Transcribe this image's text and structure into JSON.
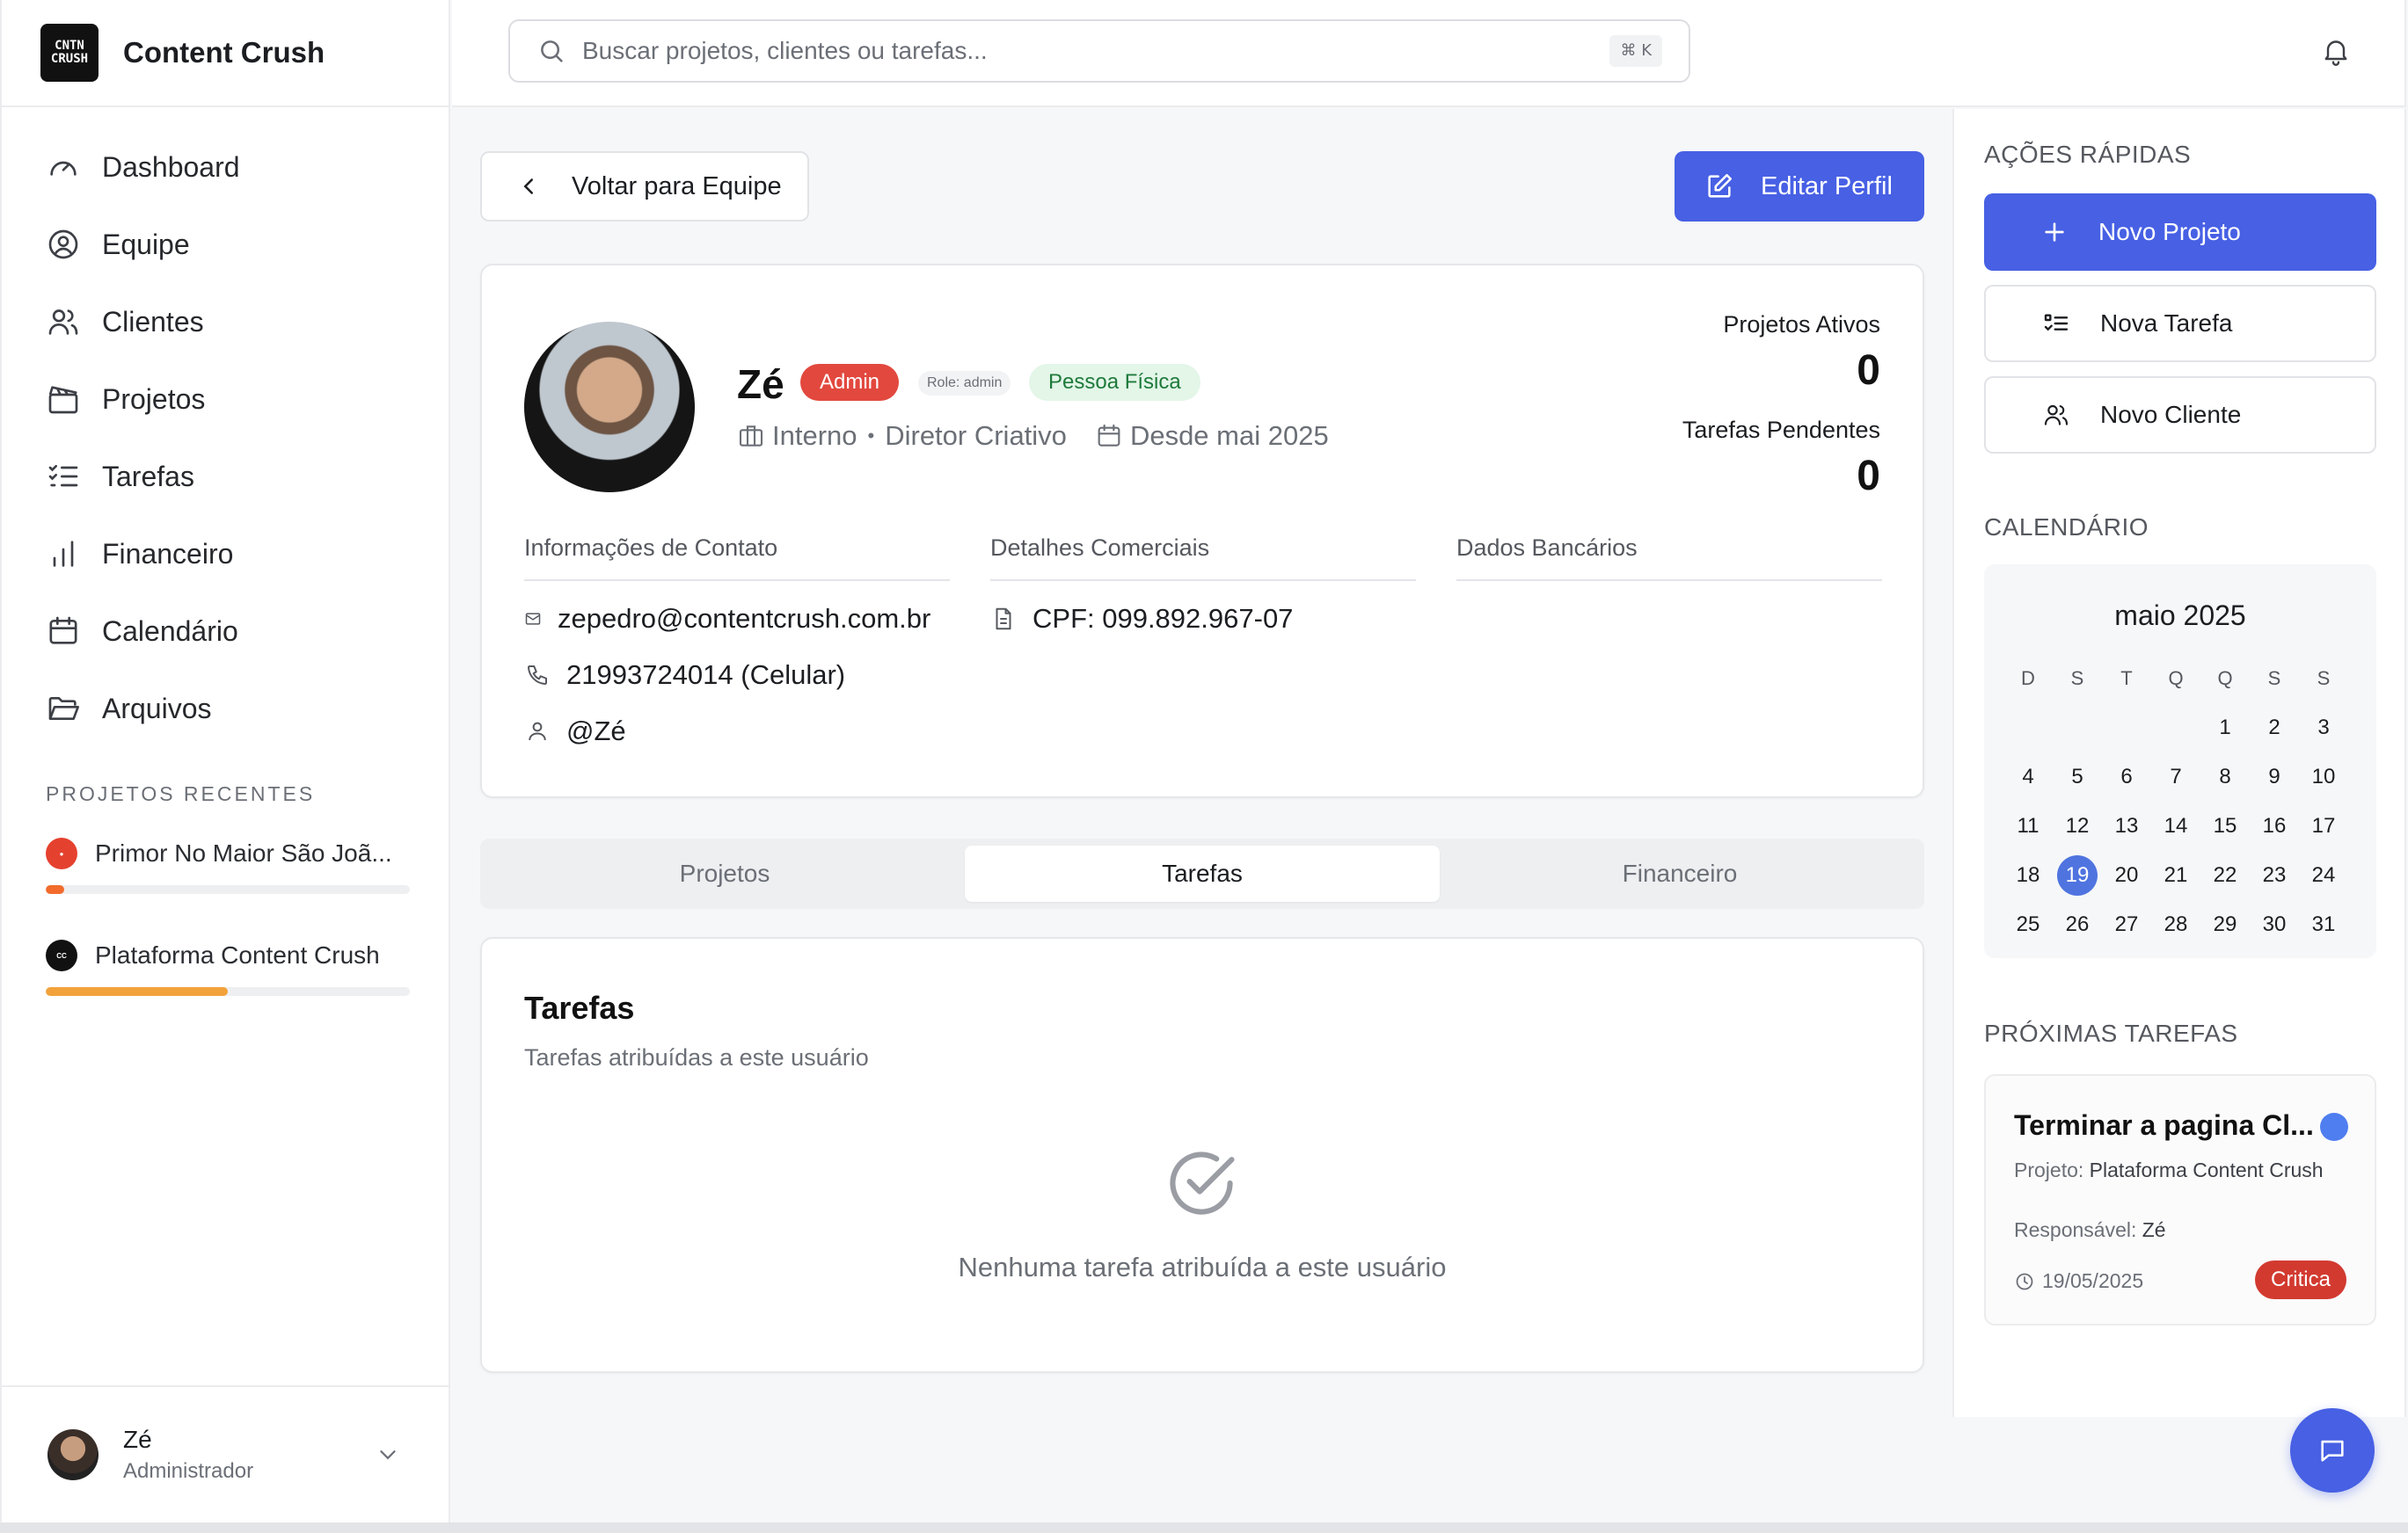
{
  "brand": {
    "name": "Content Crush",
    "logo_text": "CNTN CRUSH"
  },
  "nav": [
    {
      "label": "Dashboard",
      "icon": "gauge-icon"
    },
    {
      "label": "Equipe",
      "icon": "user-circle-icon"
    },
    {
      "label": "Clientes",
      "icon": "users-icon"
    },
    {
      "label": "Projetos",
      "icon": "clapperboard-icon"
    },
    {
      "label": "Tarefas",
      "icon": "list-checks-icon"
    },
    {
      "label": "Financeiro",
      "icon": "bar-chart-icon"
    },
    {
      "label": "Calendário",
      "icon": "calendar-icon"
    },
    {
      "label": "Arquivos",
      "icon": "folder-open-icon"
    }
  ],
  "recent_projects": {
    "label": "PROJETOS RECENTES",
    "items": [
      {
        "name": "Primor No Maior São Joã...",
        "progress": 0.05,
        "color": "#f26b2c"
      },
      {
        "name": "Plataforma Content Crush",
        "progress": 0.5,
        "color": "#f2a23a"
      }
    ]
  },
  "current_user": {
    "name": "Zé",
    "role": "Administrador"
  },
  "search": {
    "placeholder": "Buscar projetos, clientes ou tarefas...",
    "shortcut": "⌘ K"
  },
  "actions": {
    "back": "Voltar para Equipe",
    "edit": "Editar Perfil"
  },
  "profile": {
    "name": "Zé",
    "badge_admin": "Admin",
    "badge_role": "Role: admin",
    "badge_type": "Pessoa Física",
    "department": "Interno",
    "separator": "•",
    "title": "Diretor Criativo",
    "since": "Desde mai 2025",
    "stats": {
      "active_projects_label": "Projetos Ativos",
      "active_projects": "0",
      "pending_tasks_label": "Tarefas Pendentes",
      "pending_tasks": "0"
    },
    "contact": {
      "heading": "Informações de Contato",
      "email": "zepedro@contentcrush.com.br",
      "phone": "21993724014 (Celular)",
      "handle": "@Zé"
    },
    "commercial": {
      "heading": "Detalhes Comerciais",
      "cpf": "CPF: 099.892.967-07"
    },
    "bank": {
      "heading": "Dados Bancários"
    }
  },
  "tabs": [
    {
      "label": "Projetos",
      "active": false
    },
    {
      "label": "Tarefas",
      "active": true
    },
    {
      "label": "Financeiro",
      "active": false
    }
  ],
  "tasks_panel": {
    "title": "Tarefas",
    "subtitle": "Tarefas atribuídas a este usuário",
    "empty": "Nenhuma tarefa atribuída a este usuário"
  },
  "quick_actions": {
    "label": "AÇÕES RÁPIDAS",
    "new_project": "Novo Projeto",
    "new_task": "Nova Tarefa",
    "new_client": "Novo Cliente"
  },
  "calendar": {
    "label": "CALENDÁRIO",
    "month": "maio 2025",
    "weekdays": [
      "D",
      "S",
      "T",
      "Q",
      "Q",
      "S",
      "S"
    ],
    "weeks": [
      [
        "",
        "",
        "",
        "",
        "1",
        "2",
        "3"
      ],
      [
        "4",
        "5",
        "6",
        "7",
        "8",
        "9",
        "10"
      ],
      [
        "11",
        "12",
        "13",
        "14",
        "15",
        "16",
        "17"
      ],
      [
        "18",
        "19",
        "20",
        "21",
        "22",
        "23",
        "24"
      ],
      [
        "25",
        "26",
        "27",
        "28",
        "29",
        "30",
        "31"
      ]
    ],
    "today": "19"
  },
  "upcoming": {
    "label": "PRÓXIMAS TAREFAS",
    "task": {
      "title": "Terminar a pagina Cl...",
      "project_label": "Projeto:",
      "project": "Plataforma Content Crush",
      "assignee_label": "Responsável:",
      "assignee": "Zé",
      "date": "19/05/2025",
      "priority": "Critica"
    }
  },
  "colors": {
    "primary": "#4760e4",
    "admin_badge": "#e2483e",
    "critical": "#d23a30",
    "success_bg": "#e3f6e8"
  }
}
